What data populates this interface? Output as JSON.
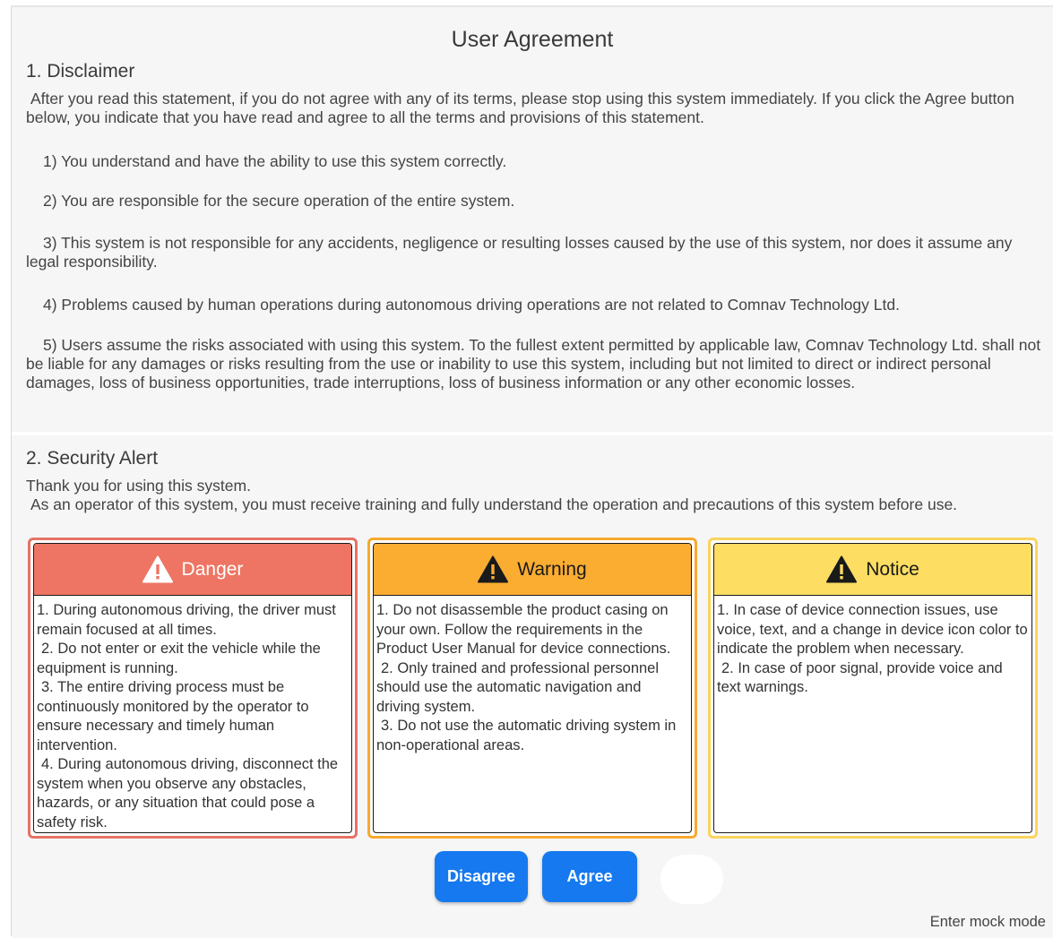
{
  "title": "User Agreement",
  "disclaimer": {
    "heading": "1. Disclaimer",
    "intro": "After you read this statement, if you do not agree with any of its terms, please stop using this system immediately. If you click the Agree button below, you indicate that you have read and agree to all the terms and provisions of this statement.",
    "items": [
      "1) You understand and have the ability to use this system correctly.",
      "2) You are responsible for the secure operation of the entire system.",
      "3) This system is not responsible for any accidents, negligence or resulting losses caused by the use of this system, nor does it assume any legal responsibility.",
      "4) Problems caused by human operations during autonomous driving operations are not related to Comnav Technology Ltd.",
      "5) Users assume the risks associated with using this system. To the fullest extent permitted by applicable law, Comnav Technology Ltd. shall not be liable for any damages or risks resulting from the use or inability to use this system, including but not limited to direct or indirect personal damages, loss of business opportunities, trade interruptions, loss of business information or any other economic losses."
    ]
  },
  "security": {
    "heading": "2. Security Alert",
    "thanks": "Thank you for using this system.",
    "operator": "As an operator of this system, you must receive training and fully understand the operation and precautions of this system before use."
  },
  "cards": {
    "danger": {
      "title": "Danger",
      "color": "#ee7563",
      "icon": "warning-triangle-icon",
      "lines": [
        "1. During autonomous driving, the driver must remain focused at all times.",
        "2. Do not enter or exit the vehicle while the equipment is running.",
        "3. The entire driving process must be continuously monitored by the operator to ensure necessary and timely human intervention.",
        "4. During autonomous driving, disconnect the system when you observe any obstacles, hazards, or any situation that could pose a safety risk."
      ]
    },
    "warning": {
      "title": "Warning",
      "color": "#fbad32",
      "icon": "warning-triangle-icon",
      "lines": [
        "1. Do not disassemble the product casing on your own. Follow the requirements in the Product User Manual for device connections.",
        "2. Only trained and professional personnel should use the automatic navigation and driving system.",
        "3. Do not use the automatic driving system in non-operational areas."
      ]
    },
    "notice": {
      "title": "Notice",
      "color": "#fddd62",
      "icon": "warning-triangle-icon",
      "lines": [
        "1. In case of device connection issues, use voice, text, and a change in device icon color to indicate the problem when necessary.",
        "2. In case of poor signal, provide voice and text warnings."
      ]
    }
  },
  "buttons": {
    "disagree": "Disagree",
    "agree": "Agree",
    "color": "#1679f0"
  },
  "mock_mode": "Enter mock mode"
}
